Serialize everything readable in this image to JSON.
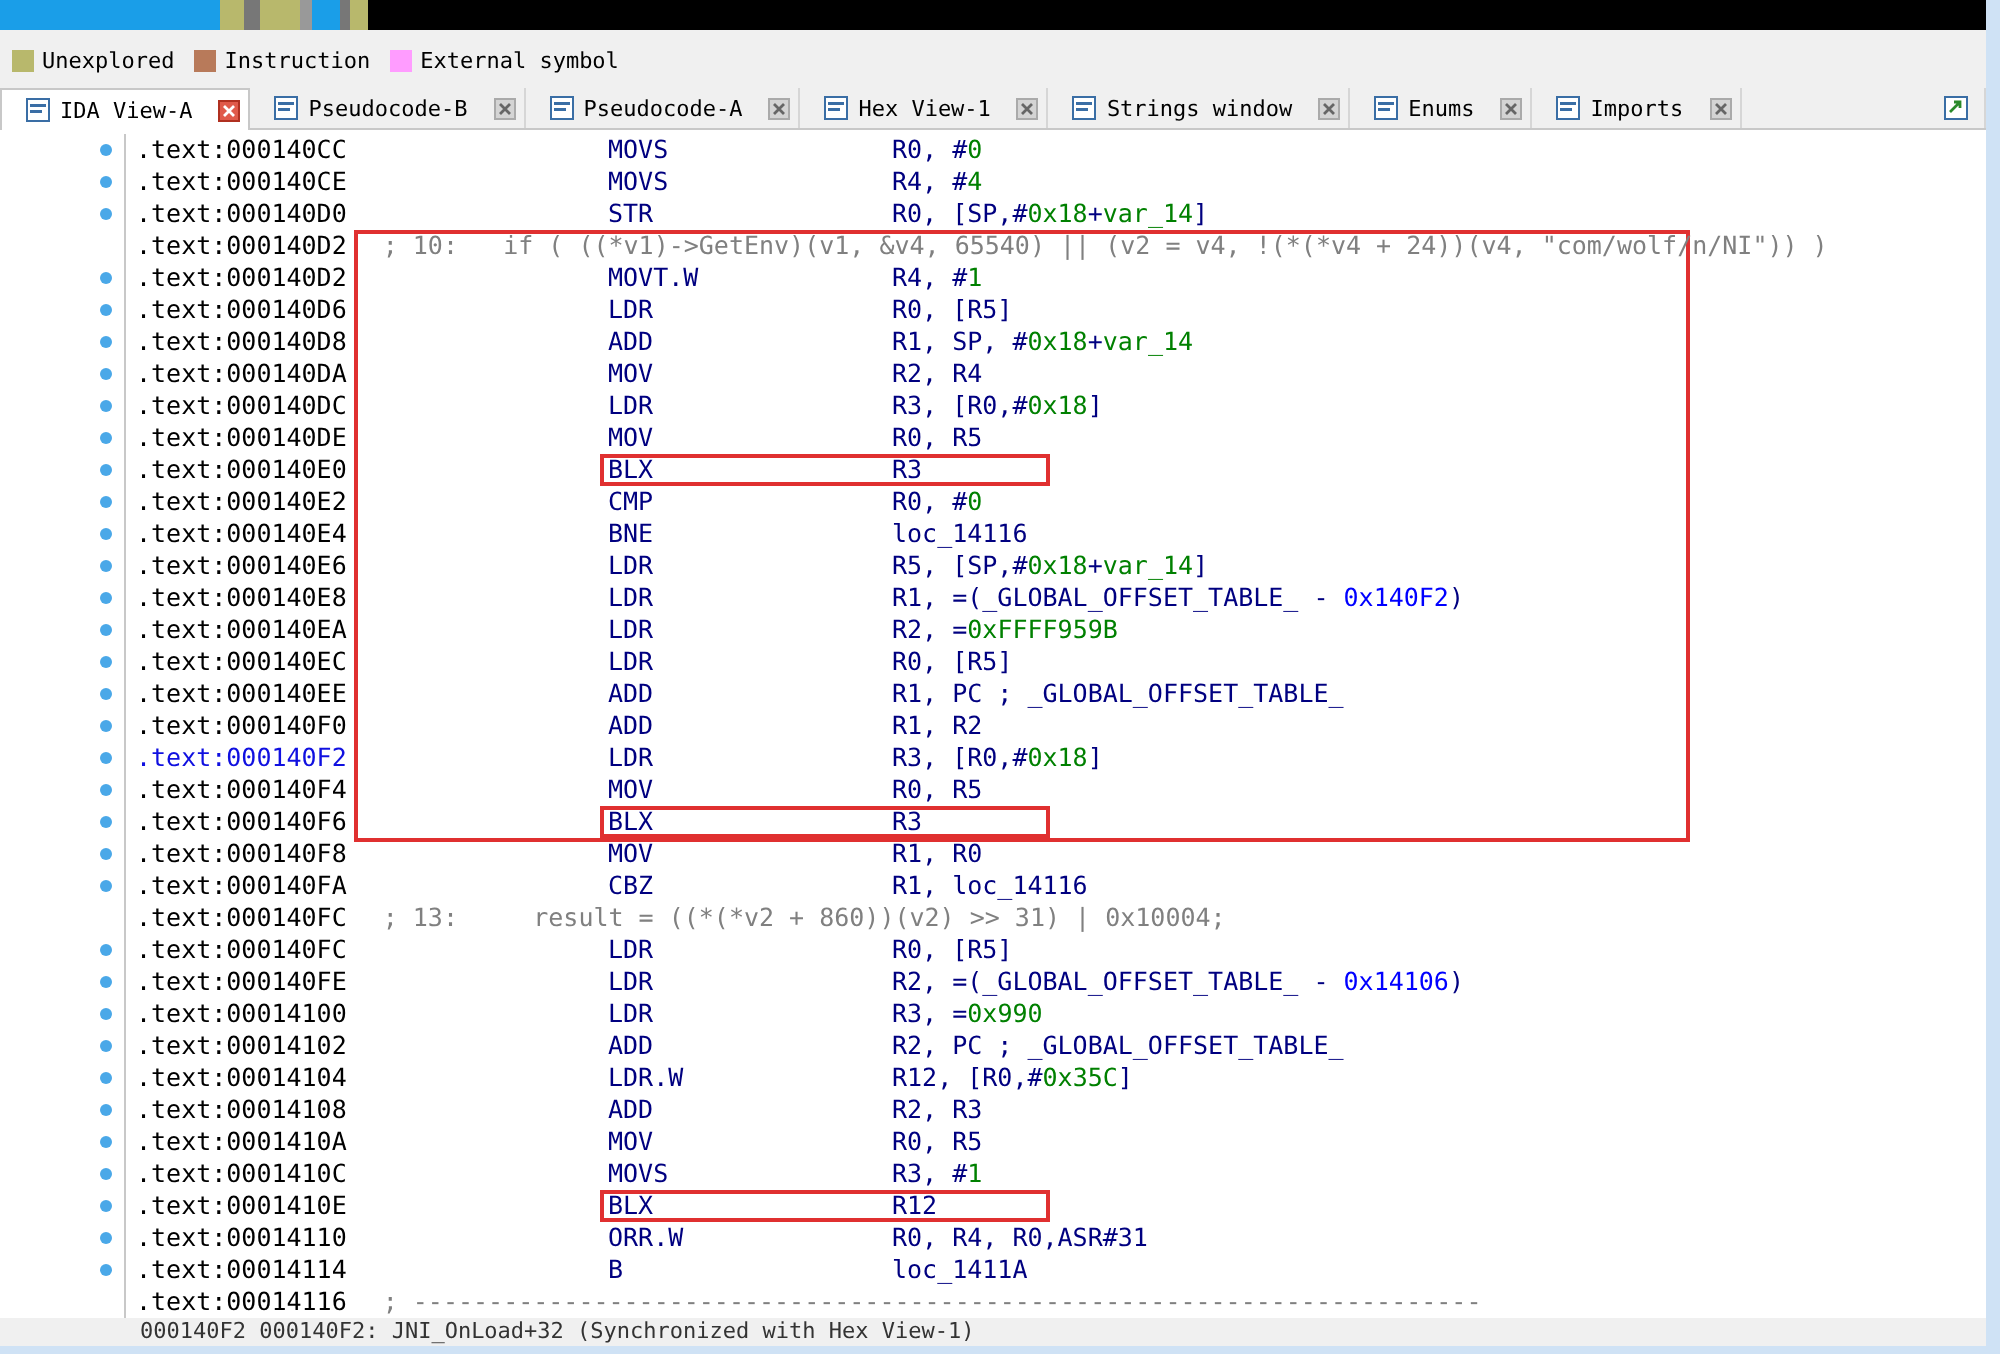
{
  "legend": [
    {
      "label": "Unexplored",
      "color": "#b8b86c"
    },
    {
      "label": "Instruction",
      "color": "#b87a5a"
    },
    {
      "label": "External symbol",
      "color": "#ff9cff"
    }
  ],
  "tabs": [
    {
      "label": "IDA View-A",
      "selected": true
    },
    {
      "label": "Pseudocode-B",
      "selected": false
    },
    {
      "label": "Pseudocode-A",
      "selected": false
    },
    {
      "label": "Hex View-1",
      "selected": false
    },
    {
      "label": "Strings window",
      "selected": false
    },
    {
      "label": "Enums",
      "selected": false
    },
    {
      "label": "Imports",
      "selected": false
    }
  ],
  "listing": [
    {
      "boxed": false,
      "lines": [
        {
          "kind": "insn",
          "address": ".text:000140CC",
          "mnemonic": "MOVS",
          "operands": [
            {
              "text": "R0, #"
            },
            {
              "text": "0",
              "kind": "num"
            }
          ]
        },
        {
          "kind": "insn",
          "address": ".text:000140CE",
          "mnemonic": "MOVS",
          "operands": [
            {
              "text": "R4, #"
            },
            {
              "text": "4",
              "kind": "num"
            }
          ]
        },
        {
          "kind": "insn",
          "address": ".text:000140D0",
          "mnemonic": "STR",
          "operands": [
            {
              "text": "R0, [SP,#"
            },
            {
              "text": "0x18",
              "kind": "num"
            },
            {
              "text": "+"
            },
            {
              "text": "var_14",
              "kind": "num"
            },
            {
              "text": "]"
            }
          ]
        }
      ]
    },
    {
      "boxed": true,
      "lines": [
        {
          "kind": "comment",
          "address": ".text:000140D2",
          "comment": "; 10:   if ( ((*v1)->GetEnv)(v1, &v4, 65540) || (v2 = v4, !(*(*v4 + 24))(v4, \"com/wolf/n/NI\")) )"
        },
        {
          "kind": "insn",
          "address": ".text:000140D2",
          "mnemonic": "MOVT.W",
          "operands": [
            {
              "text": "R4, #"
            },
            {
              "text": "1",
              "kind": "num"
            }
          ]
        },
        {
          "kind": "insn",
          "address": ".text:000140D6",
          "mnemonic": "LDR",
          "operands": [
            {
              "text": "R0, [R5]"
            }
          ]
        },
        {
          "kind": "insn",
          "address": ".text:000140D8",
          "mnemonic": "ADD",
          "operands": [
            {
              "text": "R1, SP, #"
            },
            {
              "text": "0x18",
              "kind": "num"
            },
            {
              "text": "+"
            },
            {
              "text": "var_14",
              "kind": "num"
            }
          ]
        },
        {
          "kind": "insn",
          "address": ".text:000140DA",
          "mnemonic": "MOV",
          "operands": [
            {
              "text": "R2, R4"
            }
          ]
        },
        {
          "kind": "insn",
          "address": ".text:000140DC",
          "mnemonic": "LDR",
          "operands": [
            {
              "text": "R3, [R0,#"
            },
            {
              "text": "0x18",
              "kind": "num"
            },
            {
              "text": "]"
            }
          ]
        },
        {
          "kind": "insn",
          "address": ".text:000140DE",
          "mnemonic": "MOV",
          "operands": [
            {
              "text": "R0, R5"
            }
          ]
        },
        {
          "kind": "insn",
          "marked": true,
          "address": ".text:000140E0",
          "mnemonic": "BLX",
          "operands": [
            {
              "text": "R3"
            }
          ]
        },
        {
          "kind": "insn",
          "address": ".text:000140E2",
          "mnemonic": "CMP",
          "operands": [
            {
              "text": "R0, #"
            },
            {
              "text": "0",
              "kind": "num"
            }
          ]
        },
        {
          "kind": "insn",
          "address": ".text:000140E4",
          "mnemonic": "BNE",
          "operands": [
            {
              "text": "loc_14116"
            }
          ]
        },
        {
          "kind": "insn",
          "address": ".text:000140E6",
          "mnemonic": "LDR",
          "operands": [
            {
              "text": "R5, [SP,#"
            },
            {
              "text": "0x18",
              "kind": "num"
            },
            {
              "text": "+"
            },
            {
              "text": "var_14",
              "kind": "num"
            },
            {
              "text": "]"
            }
          ]
        },
        {
          "kind": "insn",
          "address": ".text:000140E8",
          "mnemonic": "LDR",
          "operands": [
            {
              "text": "R1, =(_GLOBAL_OFFSET_TABLE_ - "
            },
            {
              "text": "0x140F2",
              "kind": "addr"
            },
            {
              "text": ")"
            }
          ]
        },
        {
          "kind": "insn",
          "address": ".text:000140EA",
          "mnemonic": "LDR",
          "operands": [
            {
              "text": "R2, ="
            },
            {
              "text": "0xFFFF959B",
              "kind": "num"
            }
          ]
        },
        {
          "kind": "insn",
          "address": ".text:000140EC",
          "mnemonic": "LDR",
          "operands": [
            {
              "text": "R0, [R5]"
            }
          ]
        },
        {
          "kind": "insn",
          "address": ".text:000140EE",
          "mnemonic": "ADD",
          "operands": [
            {
              "text": "R1, PC ; _GLOBAL_OFFSET_TABLE_"
            }
          ]
        },
        {
          "kind": "insn",
          "address": ".text:000140F0",
          "mnemonic": "ADD",
          "operands": [
            {
              "text": "R1, R2"
            }
          ]
        },
        {
          "kind": "insn",
          "selected": true,
          "address": ".text:000140F2",
          "mnemonic": "LDR",
          "operands": [
            {
              "text": "R3, [R0,#"
            },
            {
              "text": "0x18",
              "kind": "num"
            },
            {
              "text": "]"
            }
          ]
        },
        {
          "kind": "insn",
          "address": ".text:000140F4",
          "mnemonic": "MOV",
          "operands": [
            {
              "text": "R0, R5"
            }
          ]
        },
        {
          "kind": "insn",
          "marked": true,
          "address": ".text:000140F6",
          "mnemonic": "BLX",
          "operands": [
            {
              "text": "R3"
            }
          ]
        }
      ]
    },
    {
      "boxed": false,
      "lines": [
        {
          "kind": "insn",
          "address": ".text:000140F8",
          "mnemonic": "MOV",
          "operands": [
            {
              "text": "R1, R0"
            }
          ]
        },
        {
          "kind": "insn",
          "address": ".text:000140FA",
          "mnemonic": "CBZ",
          "operands": [
            {
              "text": "R1, loc_14116"
            }
          ]
        },
        {
          "kind": "comment",
          "address": ".text:000140FC",
          "comment": "; 13:     result = ((*(*v2 + 860))(v2) >> 31) | 0x10004;"
        },
        {
          "kind": "insn",
          "address": ".text:000140FC",
          "mnemonic": "LDR",
          "operands": [
            {
              "text": "R0, [R5]"
            }
          ]
        },
        {
          "kind": "insn",
          "address": ".text:000140FE",
          "mnemonic": "LDR",
          "operands": [
            {
              "text": "R2, =(_GLOBAL_OFFSET_TABLE_ - "
            },
            {
              "text": "0x14106",
              "kind": "addr"
            },
            {
              "text": ")"
            }
          ]
        },
        {
          "kind": "insn",
          "address": ".text:00014100",
          "mnemonic": "LDR",
          "operands": [
            {
              "text": "R3, ="
            },
            {
              "text": "0x990",
              "kind": "num"
            }
          ]
        },
        {
          "kind": "insn",
          "address": ".text:00014102",
          "mnemonic": "ADD",
          "operands": [
            {
              "text": "R2, PC ; _GLOBAL_OFFSET_TABLE_"
            }
          ]
        },
        {
          "kind": "insn",
          "address": ".text:00014104",
          "mnemonic": "LDR.W",
          "operands": [
            {
              "text": "R12, [R0,#"
            },
            {
              "text": "0x35C",
              "kind": "num"
            },
            {
              "text": "]"
            }
          ]
        },
        {
          "kind": "insn",
          "address": ".text:00014108",
          "mnemonic": "ADD",
          "operands": [
            {
              "text": "R2, R3"
            }
          ]
        },
        {
          "kind": "insn",
          "address": ".text:0001410A",
          "mnemonic": "MOV",
          "operands": [
            {
              "text": "R0, R5"
            }
          ]
        },
        {
          "kind": "insn",
          "address": ".text:0001410C",
          "mnemonic": "MOVS",
          "operands": [
            {
              "text": "R3, #"
            },
            {
              "text": "1",
              "kind": "num"
            }
          ]
        },
        {
          "kind": "insn",
          "marked": true,
          "address": ".text:0001410E",
          "mnemonic": "BLX",
          "operands": [
            {
              "text": "R12"
            }
          ]
        },
        {
          "kind": "insn",
          "address": ".text:00014110",
          "mnemonic": "ORR.W",
          "operands": [
            {
              "text": "R0, R4, R0,ASR#31"
            }
          ]
        },
        {
          "kind": "insn",
          "address": ".text:00014114",
          "mnemonic": "B",
          "operands": [
            {
              "text": "loc_1411A"
            }
          ]
        },
        {
          "kind": "comment",
          "address": ".text:00014116",
          "comment": "; -----------------------------------------------------------------------"
        }
      ]
    }
  ],
  "status_bar": "000140F2 000140F2: JNI_OnLoad+32 (Synchronized with Hex View-1)"
}
